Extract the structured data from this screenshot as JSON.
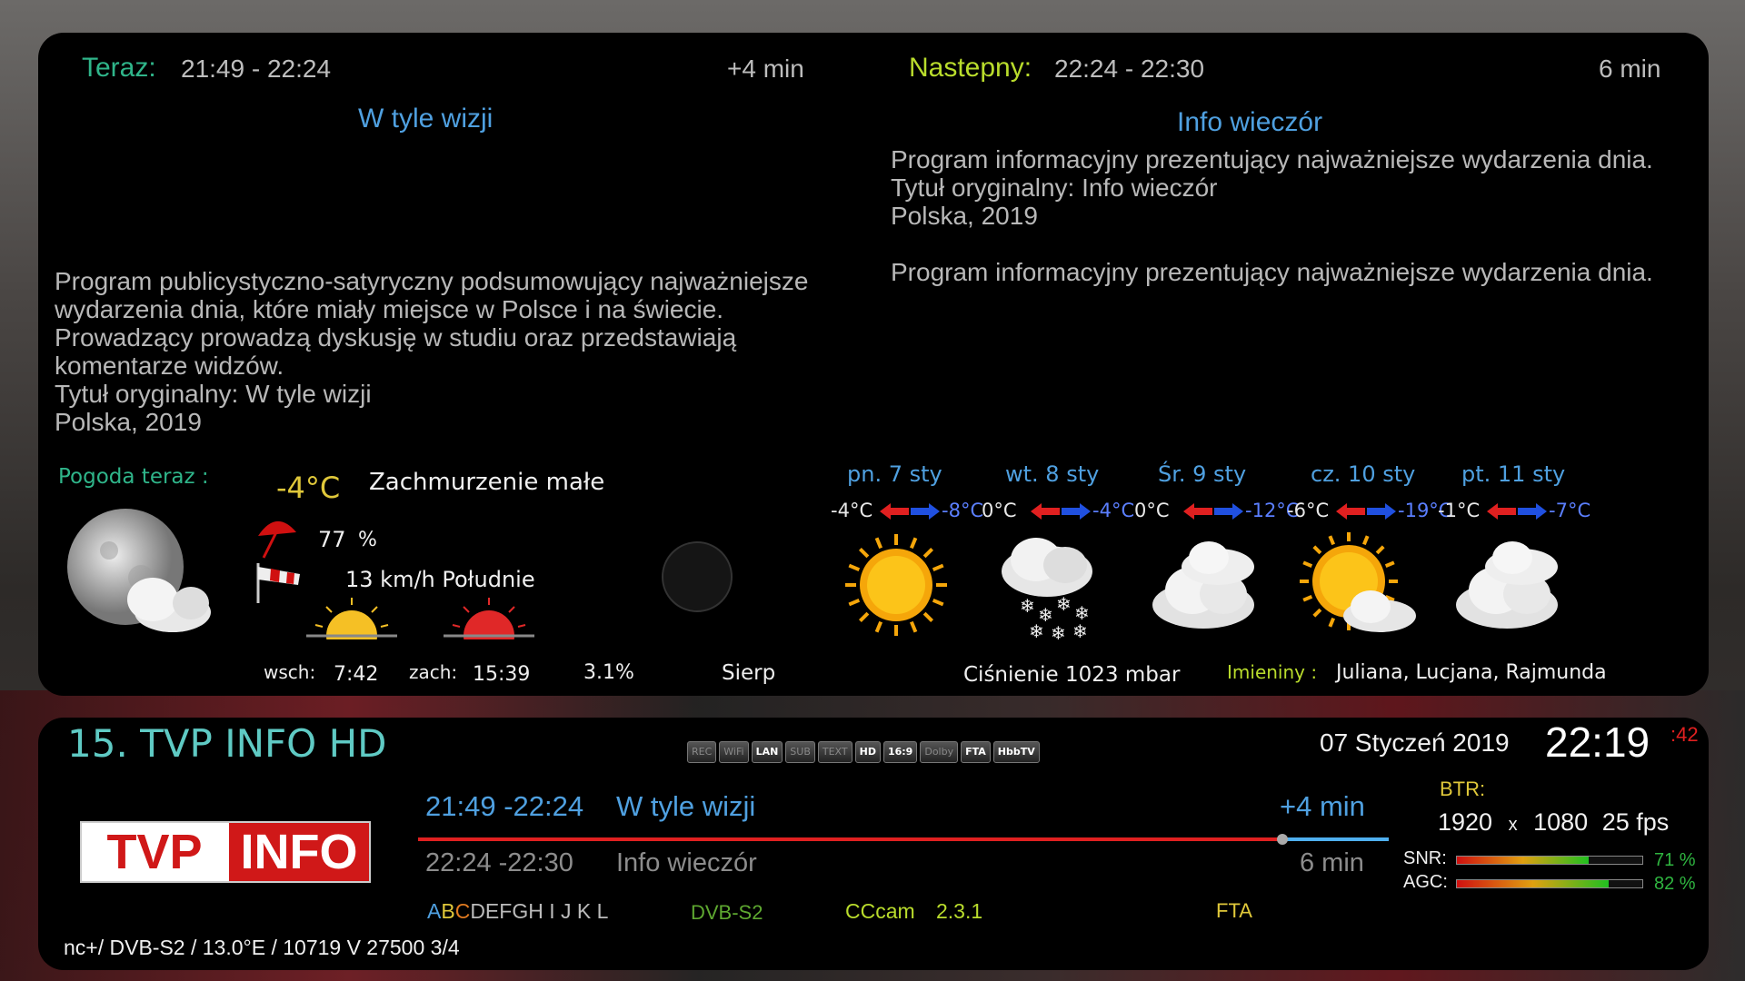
{
  "now": {
    "label": "Teraz:",
    "time": "21:49  - 22:24",
    "extra": "+4 min",
    "title": "W tyle wizji",
    "description": "Program publicystyczno-satyryczny podsumowujący najważniejsze wydarzenia dnia, które miały miejsce w Polsce i na świecie. Prowadzący prowadzą dyskusję w studiu oraz przedstawiają komentarze widzów.",
    "orig_title": "Tytuł oryginalny: W tyle wizji",
    "country": "Polska, 2019"
  },
  "next": {
    "label": "Nastepny:",
    "time": "22:24  - 22:30",
    "duration": "6  min",
    "title": "Info wieczór",
    "description": "Program informacyjny prezentujący najważniejsze wydarzenia dnia.",
    "orig_title": "Tytuł oryginalny: Info wieczór",
    "country": "Polska, 2019",
    "description2": "Program informacyjny prezentujący najważniejsze wydarzenia dnia."
  },
  "weather": {
    "label": "Pogoda teraz :",
    "temp": "-4°C",
    "condition": "Zachmurzenie małe",
    "humidity_value": "77",
    "humidity_unit": "%",
    "wind": "13 km/h Południe",
    "sunrise_label": "wsch:",
    "sunrise": "7:42",
    "sunset_label": "zach:",
    "sunset": "15:39",
    "precip": "3.1%",
    "moon_phase": "Sierp",
    "pressure_label": "Ciśnienie",
    "pressure": "1023",
    "pressure_unit": "mbar",
    "nameday_label": "Imieniny :",
    "namedays": "Juliana, Lucjana, Rajmunda",
    "forecast": [
      {
        "day": "pn. 7 sty",
        "low": "-4°C",
        "high": "-8°C",
        "icon": "sun-icon"
      },
      {
        "day": "wt. 8 sty",
        "low": "0°C",
        "high": "-4°C",
        "icon": "snow-cloud-icon"
      },
      {
        "day": "Śr. 9 sty",
        "low": "0°C",
        "high": "-12°C",
        "icon": "cloud-icon"
      },
      {
        "day": "cz. 10 sty",
        "low": "-6°C",
        "high": "-19°C",
        "icon": "sun-cloud-icon"
      },
      {
        "day": "pt. 11 sty",
        "low": "-1°C",
        "high": "-7°C",
        "icon": "cloud-icon"
      }
    ]
  },
  "channel": {
    "name": "15. TVP INFO HD",
    "logo_left": "TVP",
    "logo_right": "INFO",
    "date": "07 Styczeń 2019",
    "clock": "22:19",
    "seconds": ":42",
    "now_time": "21:49 -22:24",
    "now_title": "W tyle wizji",
    "now_extra": "+4 min",
    "progress": 0.89,
    "next_time": "22:24 -22:30",
    "next_title": "Info wieczór",
    "next_duration": "6  min",
    "letters_colored": [
      "A",
      "B",
      "C"
    ],
    "letters_rest": "DEFGH I J K L",
    "system": "DVB-S2",
    "cam": "CCcam",
    "cam_version": "2.3.1",
    "crypt": "FTA",
    "tuner": "nc+/  DVB-S2  /  13.0°E  /  10719  V  27500  3/4",
    "btr_label": "BTR:",
    "res_w": "1920",
    "res_x": "x",
    "res_h": "1080",
    "fps": "25 fps",
    "snr_label": "SNR:",
    "snr": "71 %",
    "snr_value": 0.71,
    "agc_label": "AGC:",
    "agc": "82 %",
    "agc_value": 0.82
  },
  "badges": [
    {
      "label": "REC",
      "on": false
    },
    {
      "label": "WiFi",
      "on": false
    },
    {
      "label": "LAN",
      "on": true
    },
    {
      "label": "SUB",
      "on": false
    },
    {
      "label": "TEXT",
      "on": false
    },
    {
      "label": "HD",
      "on": true
    },
    {
      "label": "16:9",
      "on": true
    },
    {
      "label": "Dolby",
      "on": false
    },
    {
      "label": "FTA",
      "on": true
    },
    {
      "label": "HbbTV",
      "on": true
    }
  ],
  "colors": {
    "label_green": "#2fb58a",
    "label_lime": "#b9dc2c",
    "title_blue": "#4fa0e0",
    "progress_red": "#e02020",
    "progress_blue": "#4fb0f0"
  }
}
